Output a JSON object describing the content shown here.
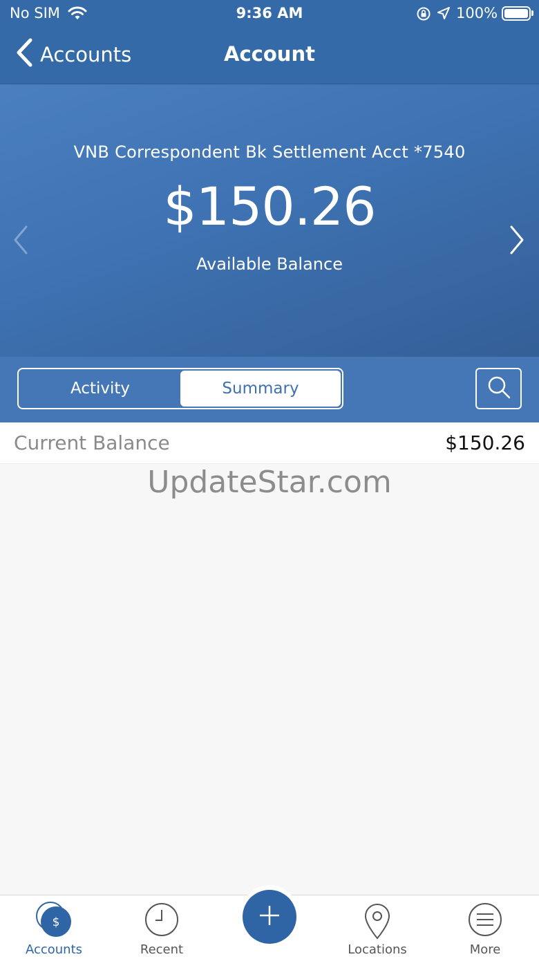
{
  "status_bar": {
    "carrier": "No SIM",
    "time": "9:36 AM",
    "battery_pct": "100%"
  },
  "nav": {
    "back_label": "Accounts",
    "title": "Account"
  },
  "hero": {
    "account_name": "VNB Correspondent Bk Settlement Acct *7540",
    "balance": "$150.26",
    "balance_label": "Available Balance"
  },
  "segments": {
    "activity": "Activity",
    "summary": "Summary",
    "selected": "Summary"
  },
  "summary": {
    "current_balance_label": "Current Balance",
    "current_balance_value": "$150.26"
  },
  "watermark": "UpdateStar.com",
  "tabs": [
    {
      "label": "Accounts",
      "icon": "dollar-icon",
      "active": true
    },
    {
      "label": "Recent",
      "icon": "clock-icon",
      "active": false
    },
    {
      "label": "",
      "icon": "plus-icon",
      "active": false
    },
    {
      "label": "Locations",
      "icon": "location-pin-icon",
      "active": false
    },
    {
      "label": "More",
      "icon": "menu-icon",
      "active": false
    }
  ],
  "colors": {
    "brand": "#356aa8",
    "accent": "#2f64a5"
  }
}
